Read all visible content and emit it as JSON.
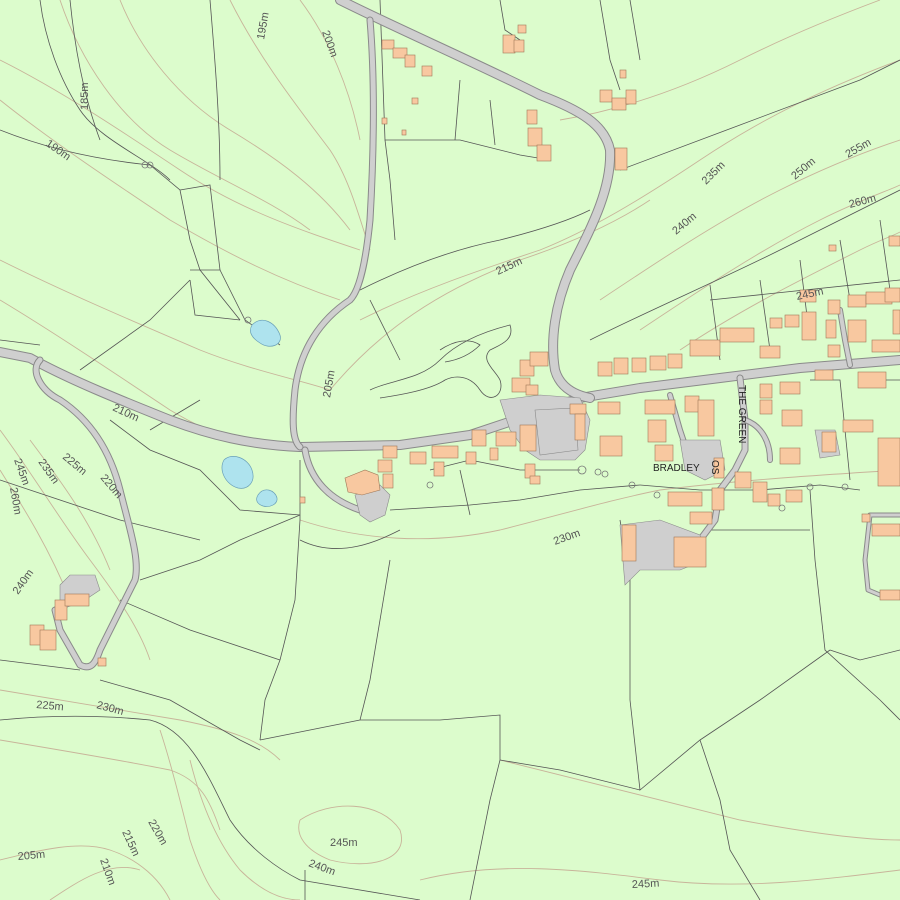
{
  "place_names": {
    "village": "BRADLEY",
    "street_1": "THE GREEN",
    "street_2": "OS"
  },
  "contour_labels": {
    "c185": "185m",
    "c195": "195m",
    "c200": "200m",
    "c190": "190m",
    "c215_north": "215m",
    "c235_ne": "235m",
    "c240_ne": "240m",
    "c250": "250m",
    "c255": "255m",
    "c260_ne": "260m",
    "c245_ne": "245m",
    "c205_mid": "205m",
    "c210_mid": "210m",
    "c245_w": "245m",
    "c235_w": "235m",
    "c225_w": "225m",
    "c220_w": "220m",
    "c260_w": "260m",
    "c240_w": "240m",
    "c230_mid": "230m",
    "c225_sw": "225m",
    "c230_sw": "230m",
    "c220_s": "220m",
    "c215_s": "215m",
    "c210_s": "210m",
    "c205_s": "205m",
    "c245_s": "245m",
    "c240_s": "240m",
    "c245_se": "245m"
  },
  "colors": {
    "land": "#dcfccc",
    "building": "#f8c8a0",
    "road": "#cfcfcf",
    "water": "#aee3ee",
    "contour": "#c8b49a"
  }
}
